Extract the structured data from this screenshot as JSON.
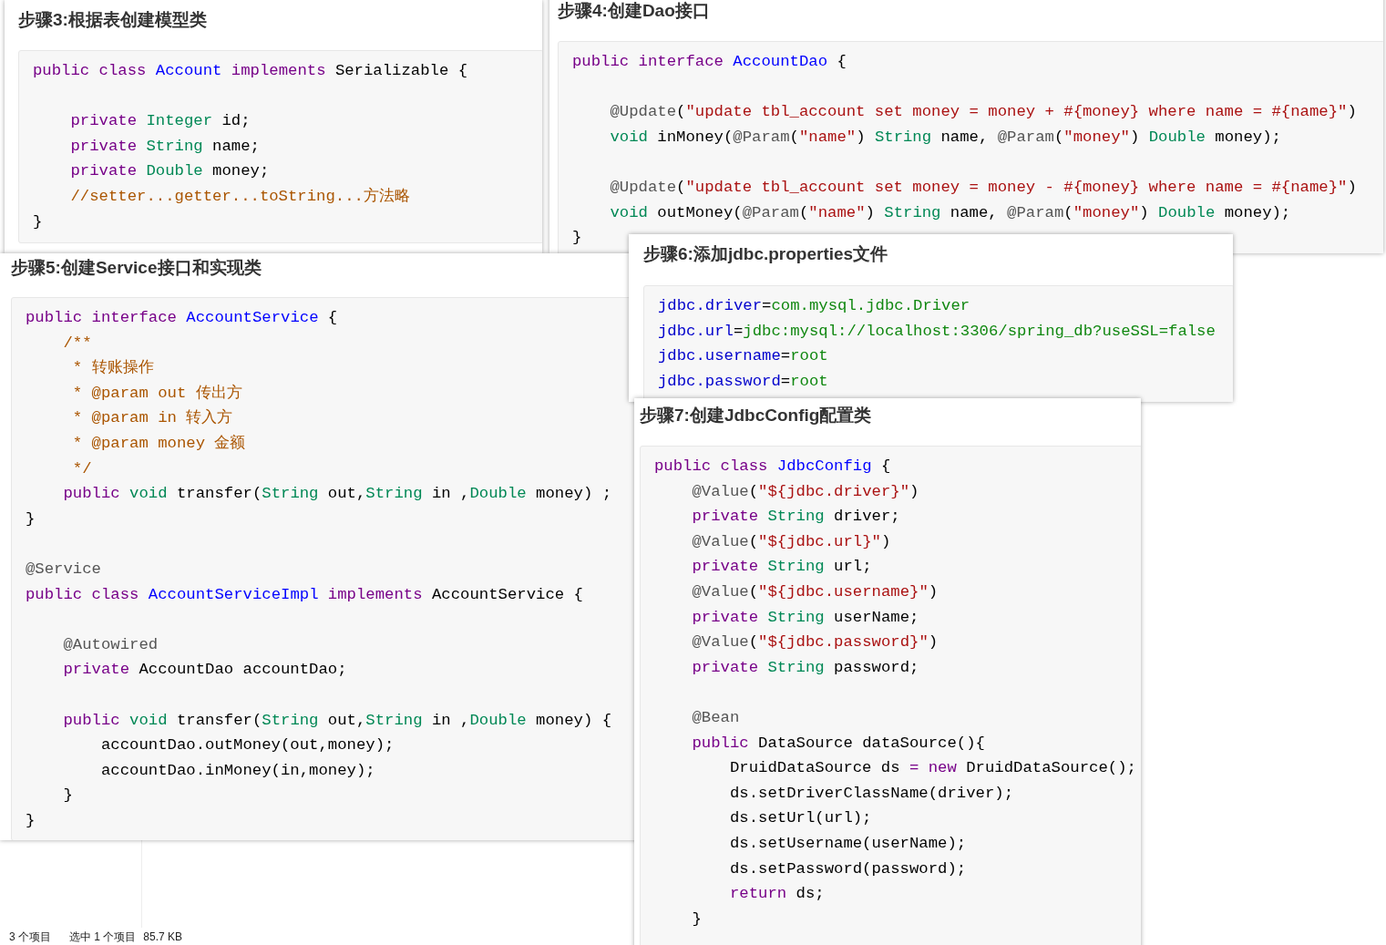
{
  "panels": [
    {
      "title": "步骤3:根据表创建模型类",
      "lines": [
        {
          "kind": "code",
          "tokens": [
            {
              "kind": "keyword",
              "text": "public class "
            },
            {
              "kind": "def",
              "text": "Account"
            },
            {
              "kind": "keyword",
              "text": " implements "
            },
            {
              "kind": "plain",
              "text": "Serializable {"
            }
          ],
          "children": [
            {
              "kind": "blank"
            },
            {
              "kind": "code",
              "tokens": [
                {
                  "kind": "keyword",
                  "text": "private "
                },
                {
                  "kind": "type",
                  "text": "Integer"
                },
                {
                  "kind": "plain",
                  "text": " id;"
                }
              ]
            },
            {
              "kind": "code",
              "tokens": [
                {
                  "kind": "keyword",
                  "text": "private "
                },
                {
                  "kind": "type",
                  "text": "String"
                },
                {
                  "kind": "plain",
                  "text": " name;"
                }
              ]
            },
            {
              "kind": "code",
              "tokens": [
                {
                  "kind": "keyword",
                  "text": "private "
                },
                {
                  "kind": "type",
                  "text": "Double"
                },
                {
                  "kind": "plain",
                  "text": " money;"
                }
              ]
            },
            {
              "kind": "code",
              "tokens": [
                {
                  "kind": "comment",
                  "text": "//setter...getter...toString...方法略"
                }
              ]
            }
          ]
        },
        {
          "kind": "code",
          "tokens": [
            {
              "kind": "plain",
              "text": "}"
            }
          ]
        }
      ]
    },
    {
      "title": "步骤4:创建Dao接口",
      "lines": [
        {
          "kind": "code",
          "tokens": [
            {
              "kind": "keyword",
              "text": "public interface "
            },
            {
              "kind": "def",
              "text": "AccountDao"
            },
            {
              "kind": "plain",
              "text": " {"
            }
          ],
          "children": [
            {
              "kind": "blank"
            },
            {
              "kind": "code",
              "tokens": [
                {
                  "kind": "meta",
                  "text": "@Update"
                },
                {
                  "kind": "plain",
                  "text": "("
                },
                {
                  "kind": "string",
                  "text": "\"update tbl_account set money = money + #{money} where name = #{name}\""
                },
                {
                  "kind": "plain",
                  "text": ")"
                }
              ]
            },
            {
              "kind": "code",
              "tokens": [
                {
                  "kind": "type",
                  "text": "void"
                },
                {
                  "kind": "plain",
                  "text": " inMoney("
                },
                {
                  "kind": "meta",
                  "text": "@Param"
                },
                {
                  "kind": "plain",
                  "text": "("
                },
                {
                  "kind": "string",
                  "text": "\"name\""
                },
                {
                  "kind": "plain",
                  "text": ") "
                },
                {
                  "kind": "type",
                  "text": "String"
                },
                {
                  "kind": "plain",
                  "text": " name, "
                },
                {
                  "kind": "meta",
                  "text": "@Param"
                },
                {
                  "kind": "plain",
                  "text": "("
                },
                {
                  "kind": "string",
                  "text": "\"money\""
                },
                {
                  "kind": "plain",
                  "text": ") "
                },
                {
                  "kind": "type",
                  "text": "Double"
                },
                {
                  "kind": "plain",
                  "text": " money);"
                }
              ]
            },
            {
              "kind": "blank"
            },
            {
              "kind": "code",
              "tokens": [
                {
                  "kind": "meta",
                  "text": "@Update"
                },
                {
                  "kind": "plain",
                  "text": "("
                },
                {
                  "kind": "string",
                  "text": "\"update tbl_account set money = money - #{money} where name = #{name}\""
                },
                {
                  "kind": "plain",
                  "text": ")"
                }
              ]
            },
            {
              "kind": "code",
              "tokens": [
                {
                  "kind": "type",
                  "text": "void"
                },
                {
                  "kind": "plain",
                  "text": " outMoney("
                },
                {
                  "kind": "meta",
                  "text": "@Param"
                },
                {
                  "kind": "plain",
                  "text": "("
                },
                {
                  "kind": "string",
                  "text": "\"name\""
                },
                {
                  "kind": "plain",
                  "text": ") "
                },
                {
                  "kind": "type",
                  "text": "String"
                },
                {
                  "kind": "plain",
                  "text": " name, "
                },
                {
                  "kind": "meta",
                  "text": "@Param"
                },
                {
                  "kind": "plain",
                  "text": "("
                },
                {
                  "kind": "string",
                  "text": "\"money\""
                },
                {
                  "kind": "plain",
                  "text": ") "
                },
                {
                  "kind": "type",
                  "text": "Double"
                },
                {
                  "kind": "plain",
                  "text": " money);"
                }
              ]
            }
          ]
        },
        {
          "kind": "code",
          "tokens": [
            {
              "kind": "plain",
              "text": "}"
            }
          ]
        }
      ]
    },
    {
      "title": "步骤5:创建Service接口和实现类",
      "lines": [
        {
          "kind": "code",
          "tokens": [
            {
              "kind": "keyword",
              "text": "public interface "
            },
            {
              "kind": "def",
              "text": "AccountService"
            },
            {
              "kind": "plain",
              "text": " {"
            }
          ],
          "children": [
            {
              "kind": "code",
              "tokens": [
                {
                  "kind": "comment",
                  "text": "/**"
                }
              ]
            },
            {
              "kind": "code",
              "tokens": [
                {
                  "kind": "comment",
                  "text": " * 转账操作"
                }
              ]
            },
            {
              "kind": "code",
              "tokens": [
                {
                  "kind": "comment",
                  "text": " * @param out 传出方"
                }
              ]
            },
            {
              "kind": "code",
              "tokens": [
                {
                  "kind": "comment",
                  "text": " * @param in 转入方"
                }
              ]
            },
            {
              "kind": "code",
              "tokens": [
                {
                  "kind": "comment",
                  "text": " * @param money 金额"
                }
              ]
            },
            {
              "kind": "code",
              "tokens": [
                {
                  "kind": "comment",
                  "text": " */"
                }
              ]
            },
            {
              "kind": "code",
              "tokens": [
                {
                  "kind": "keyword",
                  "text": "public "
                },
                {
                  "kind": "type",
                  "text": "void"
                },
                {
                  "kind": "plain",
                  "text": " transfer("
                },
                {
                  "kind": "type",
                  "text": "String"
                },
                {
                  "kind": "plain",
                  "text": " out,"
                },
                {
                  "kind": "type",
                  "text": "String"
                },
                {
                  "kind": "plain",
                  "text": " in ,"
                },
                {
                  "kind": "type",
                  "text": "Double"
                },
                {
                  "kind": "plain",
                  "text": " money) ;"
                }
              ]
            }
          ]
        },
        {
          "kind": "code",
          "tokens": [
            {
              "kind": "plain",
              "text": "}"
            }
          ]
        },
        {
          "kind": "blank"
        },
        {
          "kind": "code",
          "tokens": [
            {
              "kind": "meta",
              "text": "@Service"
            }
          ]
        },
        {
          "kind": "code",
          "tokens": [
            {
              "kind": "keyword",
              "text": "public class "
            },
            {
              "kind": "def",
              "text": "AccountServiceImpl"
            },
            {
              "kind": "keyword",
              "text": " implements "
            },
            {
              "kind": "plain",
              "text": "AccountService {"
            }
          ],
          "children": [
            {
              "kind": "blank"
            },
            {
              "kind": "code",
              "tokens": [
                {
                  "kind": "meta",
                  "text": "@Autowired"
                }
              ]
            },
            {
              "kind": "code",
              "tokens": [
                {
                  "kind": "keyword",
                  "text": "private "
                },
                {
                  "kind": "plain",
                  "text": "AccountDao accountDao;"
                }
              ]
            },
            {
              "kind": "blank"
            },
            {
              "kind": "code",
              "tokens": [
                {
                  "kind": "keyword",
                  "text": "public "
                },
                {
                  "kind": "type",
                  "text": "void"
                },
                {
                  "kind": "plain",
                  "text": " transfer("
                },
                {
                  "kind": "type",
                  "text": "String"
                },
                {
                  "kind": "plain",
                  "text": " out,"
                },
                {
                  "kind": "type",
                  "text": "String"
                },
                {
                  "kind": "plain",
                  "text": " in ,"
                },
                {
                  "kind": "type",
                  "text": "Double"
                },
                {
                  "kind": "plain",
                  "text": " money) {"
                }
              ],
              "children": [
                {
                  "kind": "code",
                  "tokens": [
                    {
                      "kind": "plain",
                      "text": "accountDao.outMoney(out,money);"
                    }
                  ]
                },
                {
                  "kind": "code",
                  "tokens": [
                    {
                      "kind": "plain",
                      "text": "accountDao.inMoney(in,money);"
                    }
                  ]
                }
              ]
            },
            {
              "kind": "code",
              "tokens": [
                {
                  "kind": "plain",
                  "text": "}"
                }
              ]
            }
          ]
        },
        {
          "kind": "code",
          "tokens": [
            {
              "kind": "plain",
              "text": "}"
            }
          ]
        }
      ]
    },
    {
      "title": "步骤6:添加jdbc.properties文件",
      "lines": [
        {
          "kind": "code",
          "tokens": [
            {
              "kind": "key",
              "text": "jdbc.driver"
            },
            {
              "kind": "plain",
              "text": "="
            },
            {
              "kind": "value",
              "text": "com.mysql.jdbc.Driver"
            }
          ]
        },
        {
          "kind": "code",
          "tokens": [
            {
              "kind": "key",
              "text": "jdbc.url"
            },
            {
              "kind": "plain",
              "text": "="
            },
            {
              "kind": "value",
              "text": "jdbc:mysql://localhost:3306/spring_db?useSSL=false"
            }
          ]
        },
        {
          "kind": "code",
          "tokens": [
            {
              "kind": "key",
              "text": "jdbc.username"
            },
            {
              "kind": "plain",
              "text": "="
            },
            {
              "kind": "value",
              "text": "root"
            }
          ]
        },
        {
          "kind": "code",
          "tokens": [
            {
              "kind": "key",
              "text": "jdbc.password"
            },
            {
              "kind": "plain",
              "text": "="
            },
            {
              "kind": "value",
              "text": "root"
            }
          ]
        }
      ]
    },
    {
      "title": "步骤7:创建JdbcConfig配置类",
      "lines": [
        {
          "kind": "code",
          "tokens": [
            {
              "kind": "keyword",
              "text": "public class "
            },
            {
              "kind": "def",
              "text": "JdbcConfig"
            },
            {
              "kind": "plain",
              "text": " {"
            }
          ],
          "children": [
            {
              "kind": "code",
              "tokens": [
                {
                  "kind": "meta",
                  "text": "@Value"
                },
                {
                  "kind": "plain",
                  "text": "("
                },
                {
                  "kind": "string",
                  "text": "\"${jdbc.driver}\""
                },
                {
                  "kind": "plain",
                  "text": ")"
                }
              ]
            },
            {
              "kind": "code",
              "tokens": [
                {
                  "kind": "keyword",
                  "text": "private "
                },
                {
                  "kind": "type",
                  "text": "String"
                },
                {
                  "kind": "plain",
                  "text": " driver;"
                }
              ]
            },
            {
              "kind": "code",
              "tokens": [
                {
                  "kind": "meta",
                  "text": "@Value"
                },
                {
                  "kind": "plain",
                  "text": "("
                },
                {
                  "kind": "string",
                  "text": "\"${jdbc.url}\""
                },
                {
                  "kind": "plain",
                  "text": ")"
                }
              ]
            },
            {
              "kind": "code",
              "tokens": [
                {
                  "kind": "keyword",
                  "text": "private "
                },
                {
                  "kind": "type",
                  "text": "String"
                },
                {
                  "kind": "plain",
                  "text": " url;"
                }
              ]
            },
            {
              "kind": "code",
              "tokens": [
                {
                  "kind": "meta",
                  "text": "@Value"
                },
                {
                  "kind": "plain",
                  "text": "("
                },
                {
                  "kind": "string",
                  "text": "\"${jdbc.username}\""
                },
                {
                  "kind": "plain",
                  "text": ")"
                }
              ]
            },
            {
              "kind": "code",
              "tokens": [
                {
                  "kind": "keyword",
                  "text": "private "
                },
                {
                  "kind": "type",
                  "text": "String"
                },
                {
                  "kind": "plain",
                  "text": " userName;"
                }
              ]
            },
            {
              "kind": "code",
              "tokens": [
                {
                  "kind": "meta",
                  "text": "@Value"
                },
                {
                  "kind": "plain",
                  "text": "("
                },
                {
                  "kind": "string",
                  "text": "\"${jdbc.password}\""
                },
                {
                  "kind": "plain",
                  "text": ")"
                }
              ]
            },
            {
              "kind": "code",
              "tokens": [
                {
                  "kind": "keyword",
                  "text": "private "
                },
                {
                  "kind": "type",
                  "text": "String"
                },
                {
                  "kind": "plain",
                  "text": " password;"
                }
              ]
            },
            {
              "kind": "blank"
            },
            {
              "kind": "code",
              "tokens": [
                {
                  "kind": "meta",
                  "text": "@Bean"
                }
              ]
            },
            {
              "kind": "code",
              "tokens": [
                {
                  "kind": "keyword",
                  "text": "public "
                },
                {
                  "kind": "plain",
                  "text": "DataSource dataSource(){"
                }
              ],
              "children": [
                {
                  "kind": "code",
                  "tokens": [
                    {
                      "kind": "plain",
                      "text": "DruidDataSource ds "
                    },
                    {
                      "kind": "keyword",
                      "text": "= new"
                    },
                    {
                      "kind": "plain",
                      "text": " DruidDataSource();"
                    }
                  ]
                },
                {
                  "kind": "code",
                  "tokens": [
                    {
                      "kind": "plain",
                      "text": "ds.setDriverClassName(driver);"
                    }
                  ]
                },
                {
                  "kind": "code",
                  "tokens": [
                    {
                      "kind": "plain",
                      "text": "ds.setUrl(url);"
                    }
                  ]
                },
                {
                  "kind": "code",
                  "tokens": [
                    {
                      "kind": "plain",
                      "text": "ds.setUsername(userName);"
                    }
                  ]
                },
                {
                  "kind": "code",
                  "tokens": [
                    {
                      "kind": "plain",
                      "text": "ds.setPassword(password);"
                    }
                  ]
                },
                {
                  "kind": "code",
                  "tokens": [
                    {
                      "kind": "keyword",
                      "text": "return"
                    },
                    {
                      "kind": "plain",
                      "text": " ds;"
                    }
                  ]
                }
              ]
            },
            {
              "kind": "code",
              "tokens": [
                {
                  "kind": "plain",
                  "text": "}"
                }
              ]
            }
          ]
        }
      ]
    }
  ],
  "status_bar": {
    "items": [
      "3 个项目",
      "选中 1 个项目",
      "85.7 KB"
    ]
  }
}
